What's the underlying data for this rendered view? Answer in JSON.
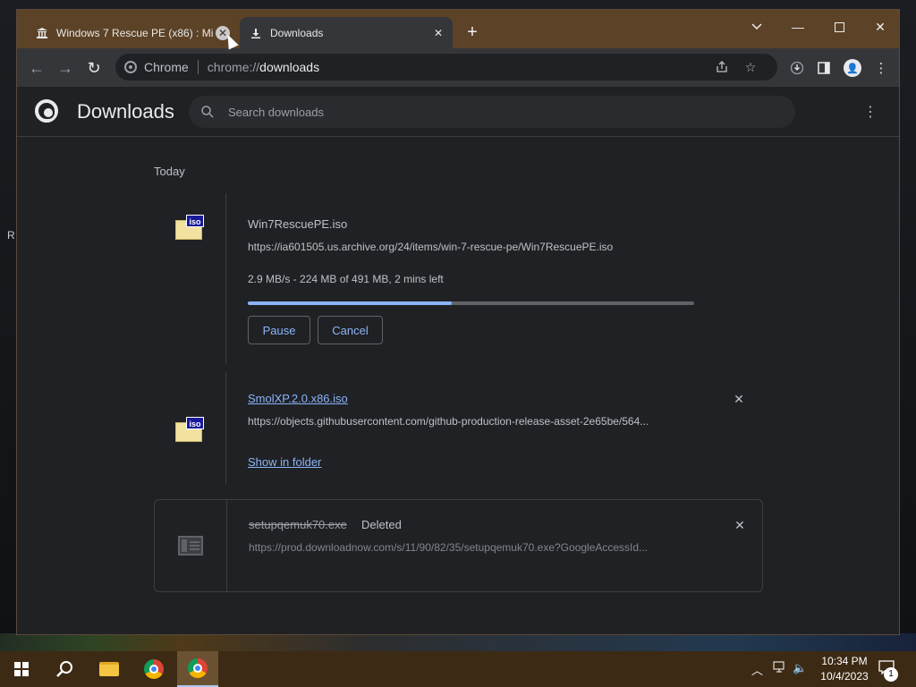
{
  "browser": {
    "tabs": [
      {
        "title": "Windows 7 Rescue PE (x86) : Mi",
        "icon": "archive-building-icon",
        "active": false
      },
      {
        "title": "Downloads",
        "icon": "download-arrow-icon",
        "active": true
      }
    ],
    "omnibox": {
      "label": "Chrome",
      "url_scheme": "chrome://",
      "url_path": "downloads"
    }
  },
  "downloads_page": {
    "title": "Downloads",
    "search_placeholder": "Search downloads",
    "date_group": "Today",
    "items": [
      {
        "filename": "Win7RescuePE.iso",
        "url": "https://ia601505.us.archive.org/24/items/win-7-rescue-pe/Win7RescuePE.iso",
        "progress_text": "2.9 MB/s - 224 MB of 491 MB, 2 mins left",
        "progress_fraction": 0.456,
        "buttons": [
          "Pause",
          "Cancel"
        ]
      },
      {
        "filename": "SmolXP.2.0.x86.iso",
        "url": "https://objects.githubusercontent.com/github-production-release-asset-2e65be/564...",
        "action": "Show in folder"
      },
      {
        "filename": "setupqemuk70.exe",
        "status": "Deleted",
        "url": "https://prod.downloadnow.com/s/11/90/82/35/setupqemuk70.exe?GoogleAccessId..."
      }
    ]
  },
  "taskbar": {
    "clock_time": "10:34 PM",
    "clock_date": "10/4/2023",
    "notification_count": "1"
  },
  "desktop": {
    "edge_glyph": "R"
  },
  "colors": {
    "accent": "#8ab4f8",
    "titlebar": "#5c4226",
    "taskbar": "#3d2a14",
    "page_bg": "#202124"
  }
}
